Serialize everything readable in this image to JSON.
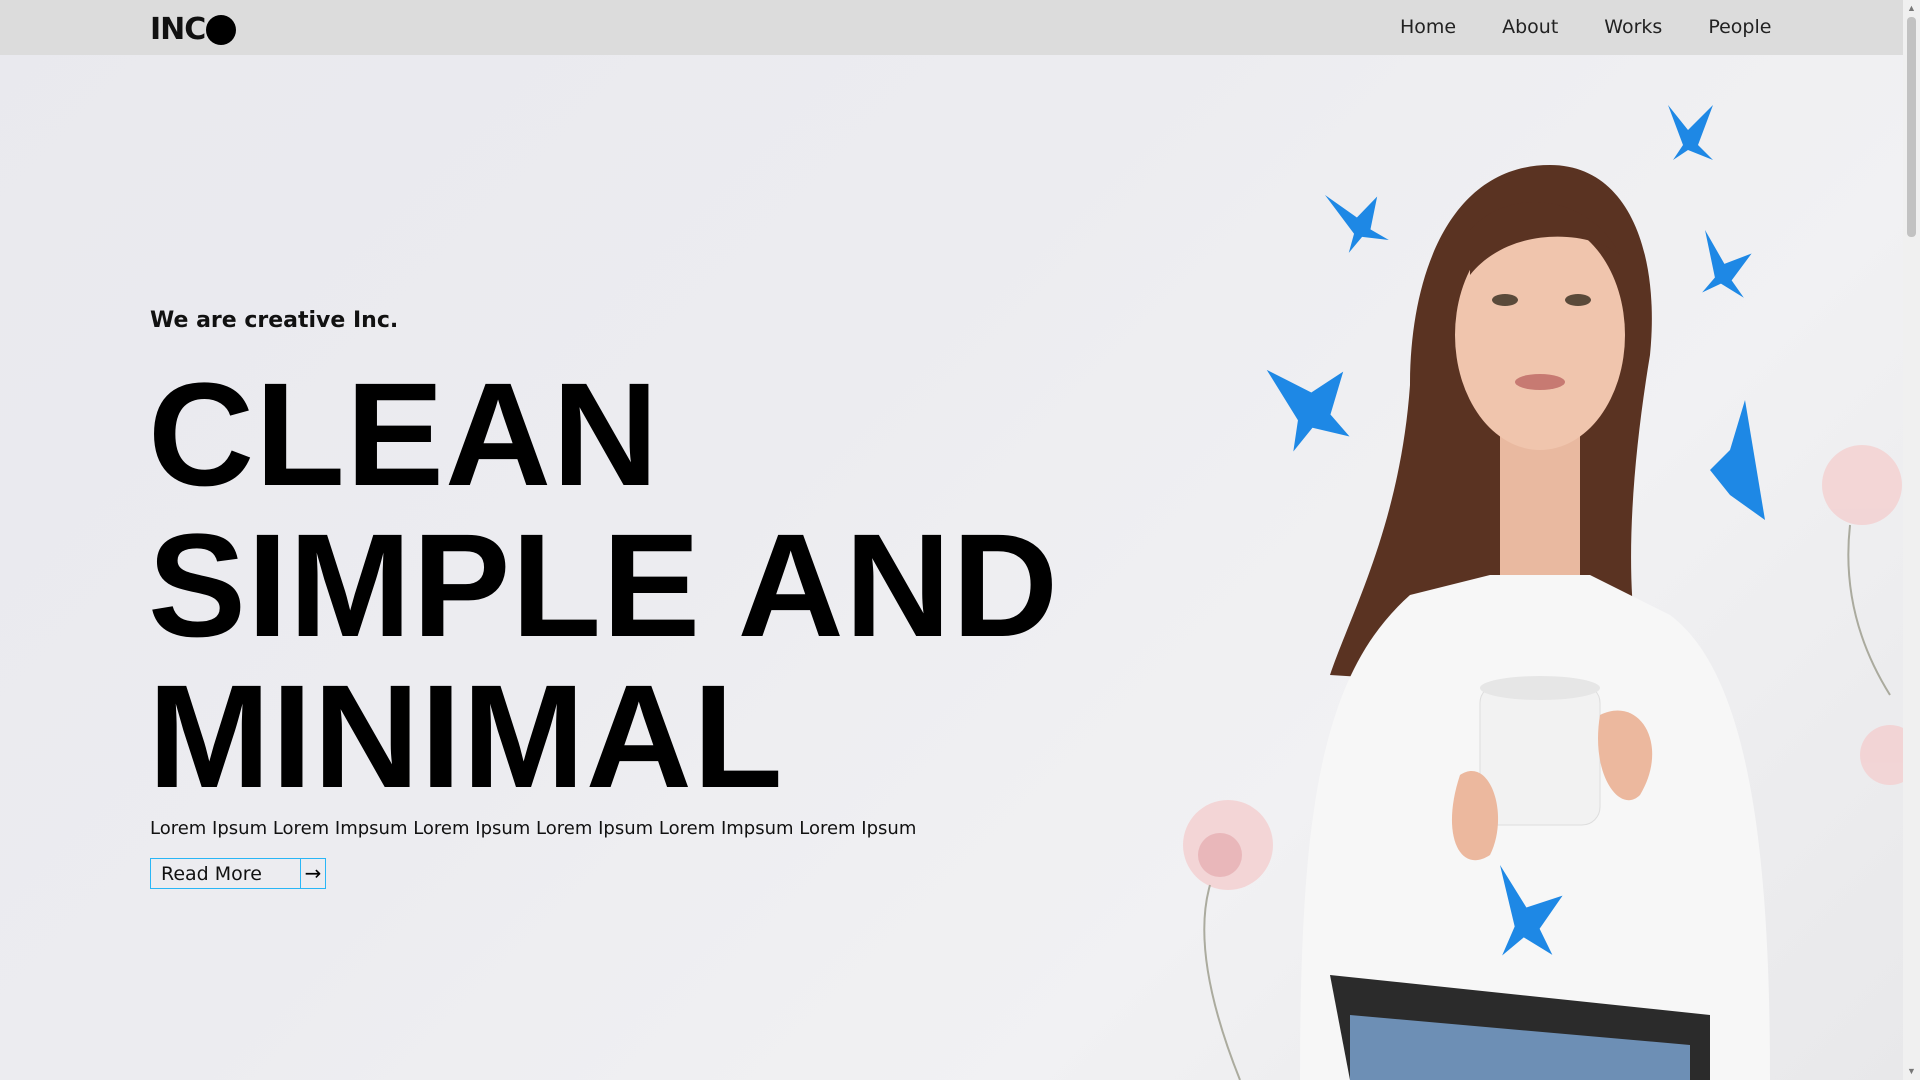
{
  "nav": {
    "logo_text": "INC",
    "items": [
      {
        "label": "Home"
      },
      {
        "label": "About"
      },
      {
        "label": "Works"
      },
      {
        "label": "People"
      }
    ]
  },
  "hero": {
    "subtitle": "We are creative Inc.",
    "headline_lines": [
      "CLEAN",
      "SIMPLE AND",
      "MINIMAL"
    ],
    "body": "Lorem Ipsum Lorem Impsum Lorem Ipsum Lorem Ipsum Lorem Impsum Lorem Ipsum",
    "button_label": "Read More",
    "button_icon": "arrow-right-icon",
    "accent_color": "#29b6f6",
    "image_description_icon": "woman-with-mug-and-butterflies-image"
  }
}
